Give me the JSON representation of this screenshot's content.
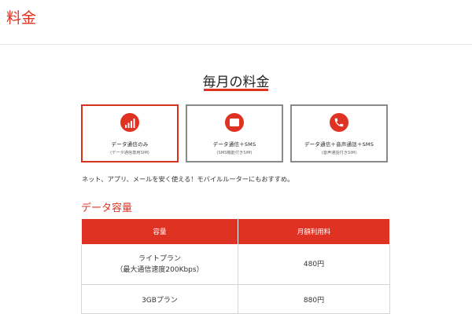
{
  "page_title": "料金",
  "section_title": "毎月の料金",
  "plans": [
    {
      "name": "データ通信のみ",
      "sub": "(データ通信専用SIM)",
      "icon": "signal-bars-icon",
      "active": true
    },
    {
      "name": "データ通信＋SMS",
      "sub": "(SMS機能付きSIM)",
      "icon": "sms-message-icon",
      "active": false
    },
    {
      "name": "データ通信＋音声通話＋SMS",
      "sub": "(音声通話付きSIM)",
      "icon": "phone-icon",
      "active": false
    }
  ],
  "description": "ネット、アプリ、メールを安く使える！モバイルルーターにもおすすめ。",
  "subsection_title": "データ容量",
  "table": {
    "headers": [
      "容量",
      "月額利用料"
    ],
    "rows": [
      {
        "capacity_line1": "ライトプラン",
        "capacity_line2": "（最大通信速度200Kbps）",
        "price": "480円"
      },
      {
        "capacity_line1": "3GBプラン",
        "capacity_line2": "",
        "price": "880円"
      }
    ]
  },
  "colors": {
    "accent": "#e03223",
    "card_border": "#8a8a8a"
  }
}
